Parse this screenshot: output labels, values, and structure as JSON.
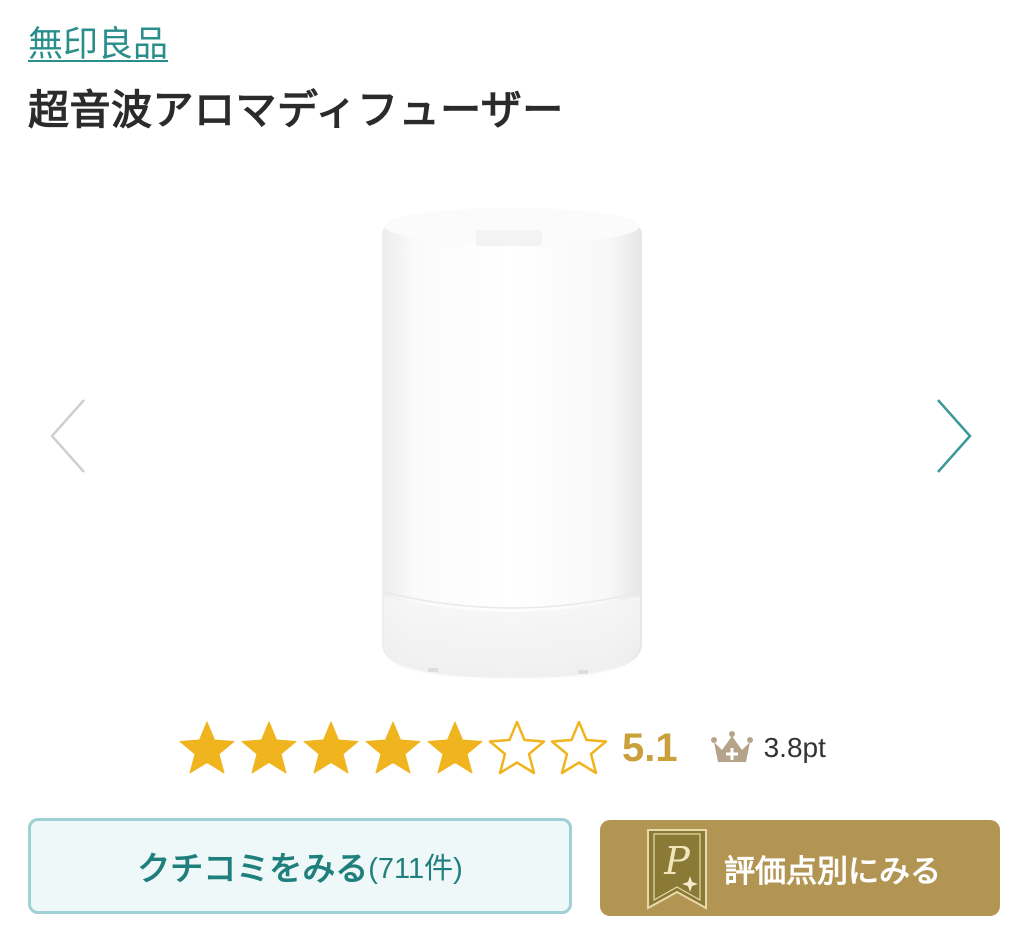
{
  "brand": {
    "name": "無印良品"
  },
  "product": {
    "title": "超音波アロマディフューザー"
  },
  "gallery": {
    "image_icon": "aroma-diffuser-image",
    "prev_icon": "chevron-left-icon",
    "next_icon": "chevron-right-icon"
  },
  "rating": {
    "stars_filled": 5,
    "stars_total": 7,
    "score": "5.1",
    "points": "3.8pt",
    "star_color": "#f0b51e"
  },
  "actions": {
    "reviews_label": "クチコミをみる",
    "reviews_count": "(711件)",
    "detail_label": "評価点別にみる"
  },
  "colors": {
    "accent_teal": "#2a8f8c",
    "gold": "#b39553"
  }
}
